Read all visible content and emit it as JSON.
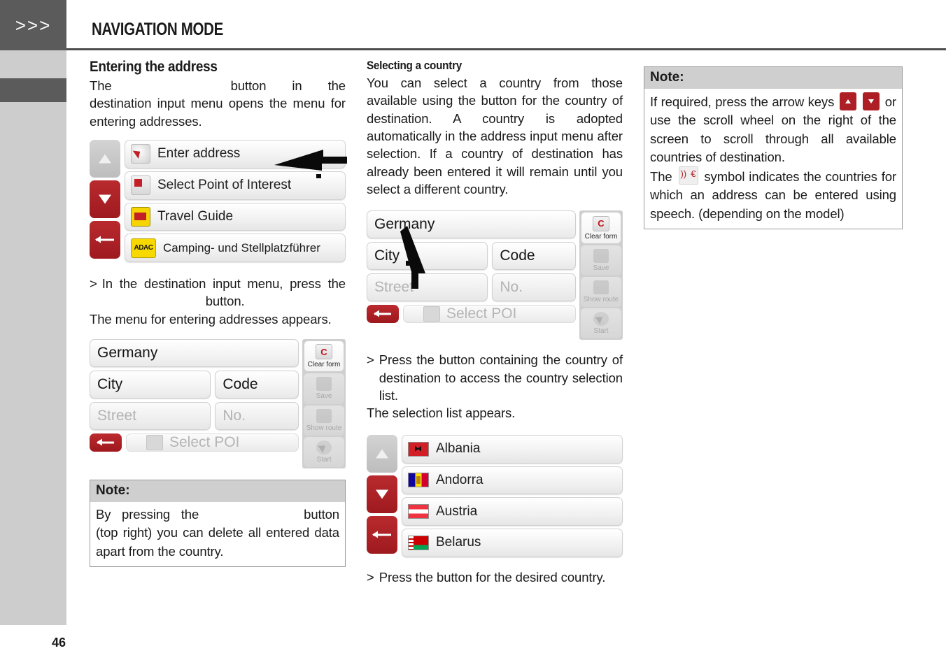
{
  "sidebar": {
    "chevrons": ">>>"
  },
  "header": {
    "title": "NAVIGATION MODE"
  },
  "page": {
    "number": "46"
  },
  "left_column": {
    "heading": "Entering the address",
    "intro_before": "The",
    "intro_after": "button in the destination input menu opens the menu for entering addresses.",
    "menu_device": {
      "nav_keys": [
        "scroll-up",
        "scroll-down",
        "back"
      ],
      "rows": [
        {
          "icon": "arrow-icon",
          "label": "Enter address"
        },
        {
          "icon": "poi-icon",
          "label": "Select Point of Interest"
        },
        {
          "icon": "travel-guide-icon",
          "label": "Travel Guide"
        },
        {
          "icon": "adac-icon",
          "label": "Camping- und Stellplatzführer",
          "badge": "ADAC"
        }
      ]
    },
    "step_marker": ">",
    "step_text_before": "In the destination input menu, press the",
    "step_text_after": "button.",
    "result_text": "The menu for entering addresses appears.",
    "form_device": {
      "country": "Germany",
      "city": "City",
      "code": "Code",
      "street": "Street",
      "no": "No.",
      "select_poi": "Select POI",
      "side_buttons": [
        {
          "label": "Clear form",
          "state": "active",
          "icon": "clear-form-icon"
        },
        {
          "label": "Save",
          "state": "disabled",
          "icon": "save-icon"
        },
        {
          "label": "Show route",
          "state": "disabled",
          "icon": "show-route-icon"
        },
        {
          "label": "Start",
          "state": "disabled",
          "icon": "start-icon"
        }
      ]
    },
    "note": {
      "title": "Note:",
      "text_before": "By pressing the",
      "text_after": "button (top right) you can delete all entered data apart from the country."
    }
  },
  "middle_column": {
    "heading": "Selecting a country",
    "body": "You can select a country from those available using the button for the country of destination. A country is adopted automatically in the address input menu after selection. If a country of destination has already been entered it will remain until you select a different country.",
    "form_device": {
      "country": "Germany",
      "city": "City",
      "code": "Code",
      "street": "Street",
      "no": "No.",
      "select_poi": "Select POI",
      "side_buttons": [
        {
          "label": "Clear form",
          "state": "active",
          "icon": "clear-form-icon"
        },
        {
          "label": "Save",
          "state": "disabled",
          "icon": "save-icon"
        },
        {
          "label": "Show route",
          "state": "disabled",
          "icon": "show-route-icon"
        },
        {
          "label": "Start",
          "state": "disabled",
          "icon": "start-icon"
        }
      ]
    },
    "step_marker": ">",
    "step_text": "Press the button containing the country of destination to access the country selection list.",
    "result_text": "The selection list appears.",
    "country_device": {
      "nav_keys": [
        "scroll-up",
        "scroll-down",
        "back"
      ],
      "countries": [
        {
          "name": "Albania",
          "flag": "flag-albania"
        },
        {
          "name": "Andorra",
          "flag": "flag-andorra"
        },
        {
          "name": "Austria",
          "flag": "flag-austria"
        },
        {
          "name": "Belarus",
          "flag": "flag-belarus"
        }
      ]
    },
    "step2_marker": ">",
    "step2_text": "Press the button for the desired country."
  },
  "right_column": {
    "note": {
      "title": "Note:",
      "part1": "If required, press the arrow keys",
      "part2": "or use the scroll wheel on the right of the screen to scroll through all available countries of destination.",
      "part3_before": "The",
      "part3_after": "symbol indicates the countries for which an address can be entered using speech. (depending on the model)"
    }
  },
  "colors": {
    "sidebar_light": "#cdcdcd",
    "sidebar_dark": "#5b5b5b",
    "accent_red": "#ad1f24",
    "note_header": "#cfcfcf"
  }
}
